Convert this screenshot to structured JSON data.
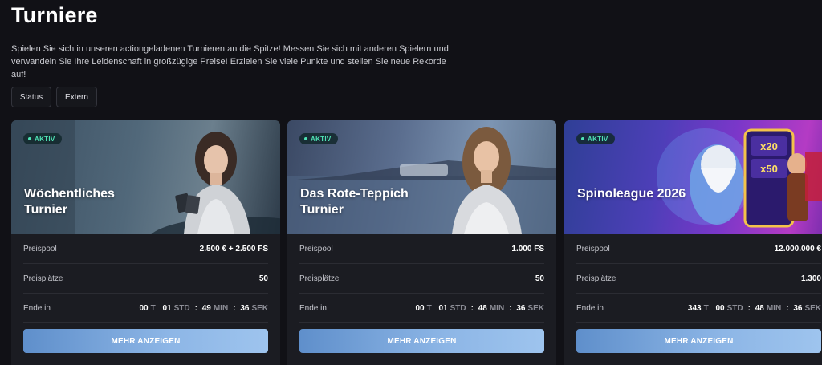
{
  "page": {
    "title": "Turniere",
    "intro_line1": "Spielen Sie sich in unseren actiongeladenen Turnieren an die Spitze! Messen Sie sich mit anderen Spielern und",
    "intro_line2": "verwandeln Sie Ihre Leidenschaft in großzügige Preise! Erzielen Sie viele Punkte und stellen Sie neue Rekorde auf!"
  },
  "filters": [
    {
      "label": "Status"
    },
    {
      "label": "Extern"
    }
  ],
  "labels": {
    "prize_pool": "Preispool",
    "places": "Preisplätze",
    "ends_in": "Ende in",
    "unit_days": "T",
    "unit_hours": "STD",
    "unit_minutes": "MIN",
    "unit_seconds": "SEK",
    "colon": ":",
    "more_button": "MEHR ANZEIGEN"
  },
  "tournaments": [
    {
      "badge": "AKTIV",
      "title": "Wöchentliches Turnier",
      "prize_pool": "2.500 € + 2.500 FS",
      "places": "50",
      "days": "00",
      "hours": "01",
      "minutes": "49",
      "seconds": "36"
    },
    {
      "badge": "AKTIV",
      "title": "Das Rote-Teppich Turnier",
      "prize_pool": "1.000 FS",
      "places": "50",
      "days": "00",
      "hours": "01",
      "minutes": "48",
      "seconds": "36"
    },
    {
      "badge": "AKTIV",
      "title": "Spinoleague 2026",
      "prize_pool": "12.000.000 €",
      "places": "1.300",
      "days": "343",
      "hours": "00",
      "minutes": "48",
      "seconds": "36"
    }
  ],
  "hero_game_text": [
    "x20",
    "x50"
  ],
  "colors": {
    "background": "#111116",
    "card": "#1b1c22",
    "badge_text": "#4fe3b5",
    "button_start": "#5f8fcb",
    "button_end": "#9ec4ee"
  }
}
